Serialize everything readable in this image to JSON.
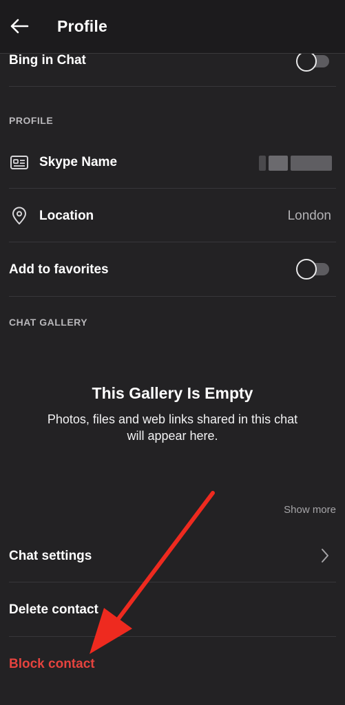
{
  "header": {
    "title": "Profile",
    "back_icon": "arrow-left-icon"
  },
  "bing_row": {
    "label": "Bing in Chat",
    "toggle_on": false
  },
  "profile_section": {
    "header": "PROFILE",
    "skype_name": {
      "label": "Skype Name",
      "icon": "id-card-icon",
      "value_obscured": true
    },
    "location": {
      "label": "Location",
      "icon": "location-pin-icon",
      "value": "London"
    },
    "favorites": {
      "label": "Add to favorites",
      "toggle_on": false
    }
  },
  "gallery_section": {
    "header": "CHAT GALLERY",
    "empty_title": "This Gallery Is Empty",
    "empty_subtitle": "Photos, files and web links shared in this chat will appear here.",
    "show_more": "Show more"
  },
  "actions": {
    "chat_settings": "Chat settings",
    "delete_contact": "Delete contact",
    "block_contact": "Block contact"
  },
  "colors": {
    "background": "#232224",
    "header_background": "#1c1b1d",
    "destructive": "#e5433e",
    "annotation_arrow": "#ee2a1f"
  }
}
